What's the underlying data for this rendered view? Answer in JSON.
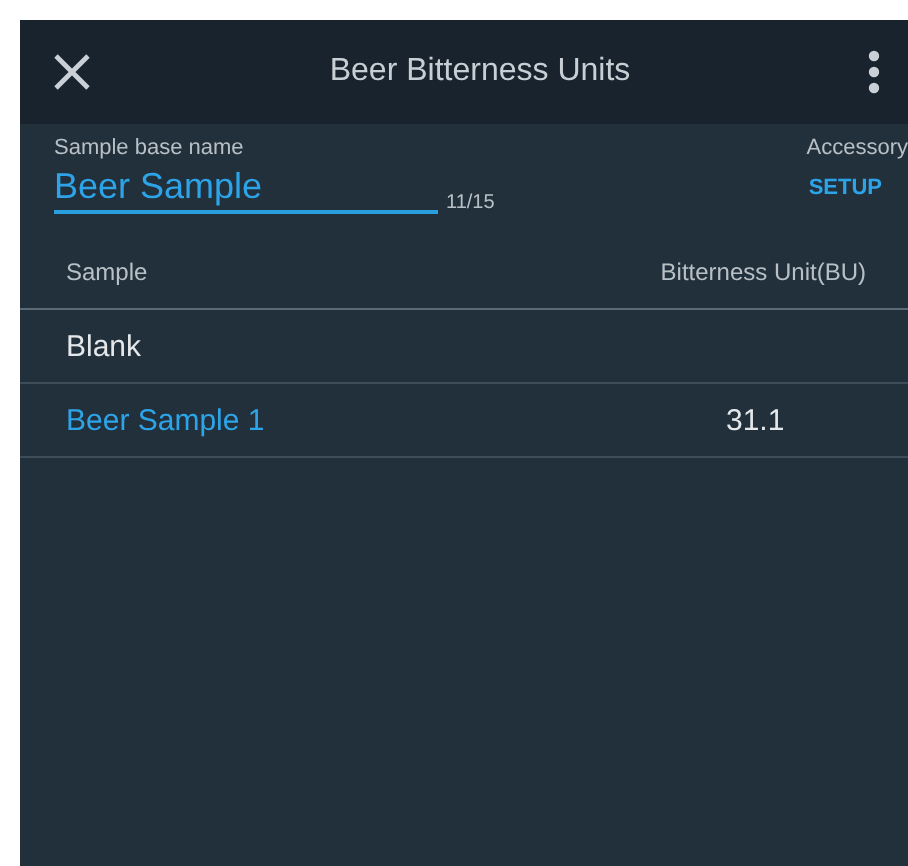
{
  "window": {
    "title": "Beer Bitterness Units"
  },
  "field": {
    "label": "Sample base name",
    "value": "Beer Sample",
    "counter": "11/15"
  },
  "accessory": {
    "label": "Accessory",
    "button": "SETUP"
  },
  "table": {
    "columns": [
      "Sample",
      "Bitterness Unit(BU)"
    ],
    "rows": [
      {
        "name": "Blank",
        "value": "",
        "selected": false
      },
      {
        "name": "Beer Sample 1",
        "value": "31.1",
        "selected": true
      }
    ]
  }
}
